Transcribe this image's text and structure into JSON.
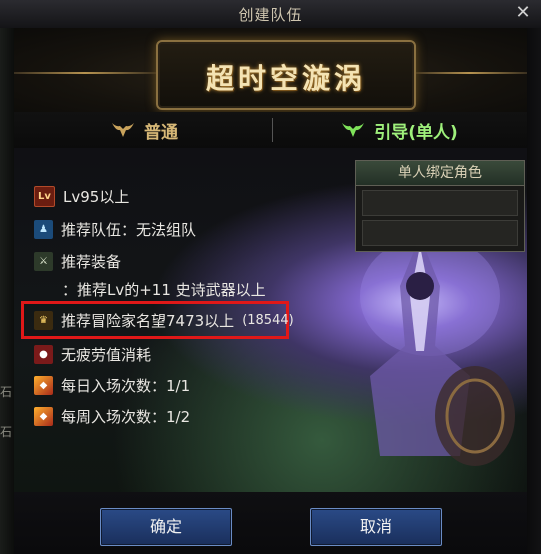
{
  "window": {
    "title": "创建队伍",
    "close_glyph": "✕"
  },
  "side_chars": {
    "left_1": "石",
    "left_2": "石"
  },
  "banner": {
    "title": "超时空漩涡"
  },
  "tabs": [
    {
      "label": "普通",
      "icon": "horned-helmet-icon",
      "color": "#d7b877"
    },
    {
      "label": "引导(单人)",
      "icon": "horned-helmet-icon",
      "color": "#9ef07b"
    }
  ],
  "bind_box": {
    "header": "单人绑定角色"
  },
  "requirements": {
    "level": {
      "icon_text": "Lv",
      "text": "Lv95以上"
    },
    "team": {
      "text": "推荐队伍：无法组队"
    },
    "equip": {
      "text": "推荐装备",
      "detail": "：推荐Lv的+11 史诗武器以上"
    },
    "fame": {
      "text": "推荐冒险家名望7473以上",
      "current": "(18544)"
    },
    "fatigue": {
      "text": "无疲劳值消耗"
    },
    "daily": {
      "text": "每日入场次数：1/1"
    },
    "weekly": {
      "text": "每周入场次数：1/2"
    }
  },
  "buttons": {
    "confirm": "确定",
    "cancel": "取消"
  },
  "colors": {
    "highlight": "#e01818",
    "button": "#2a4a86",
    "guide_tab": "#9ef07b",
    "normal_tab": "#d7b877"
  }
}
